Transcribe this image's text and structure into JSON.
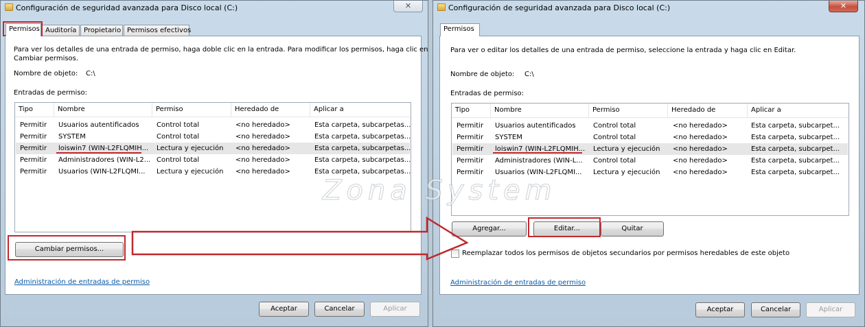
{
  "left_window": {
    "title": "Configuración de seguridad avanzada para Disco local (C:)",
    "bg_title": "Disco local (C:)",
    "close_label": "✕",
    "tabs": [
      "Permisos",
      "Auditoría",
      "Propietario",
      "Permisos efectivos"
    ],
    "description": "Para ver los detalles de una entrada de permiso, haga doble clic en la entrada. Para modificar los permisos, haga clic en",
    "description_2": "Cambiar permisos.",
    "object_name_label": "Nombre de objeto:",
    "object_name_value": "C:\\",
    "entries_label": "Entradas de permiso:",
    "columns": [
      "Tipo",
      "Nombre",
      "Permiso",
      "Heredado de",
      "Aplicar a"
    ],
    "rows": [
      {
        "tipo": "Permitir",
        "nombre": "Usuarios autentificados",
        "permiso": "Control total",
        "heredado": "<no heredado>",
        "aplicar": "Esta carpeta, subcarpetas..."
      },
      {
        "tipo": "Permitir",
        "nombre": "SYSTEM",
        "permiso": "Control total",
        "heredado": "<no heredado>",
        "aplicar": "Esta carpeta, subcarpetas..."
      },
      {
        "tipo": "Permitir",
        "nombre": "loiswin7 (WIN-L2FLQMIH...",
        "permiso": "Lectura y ejecución",
        "heredado": "<no heredado>",
        "aplicar": "Esta carpeta, subcarpetas..."
      },
      {
        "tipo": "Permitir",
        "nombre": "Administradores (WIN-L2...",
        "permiso": "Control total",
        "heredado": "<no heredado>",
        "aplicar": "Esta carpeta, subcarpetas..."
      },
      {
        "tipo": "Permitir",
        "nombre": "Usuarios (WIN-L2FLQMI...",
        "permiso": "Lectura y ejecución",
        "heredado": "<no heredado>",
        "aplicar": "Esta carpeta, subcarpetas..."
      }
    ],
    "selected_row": 2,
    "change_button": "Cambiar permisos...",
    "admin_link": "Administración de entradas de permiso",
    "ok_button": "Aceptar",
    "cancel_button": "Cancelar",
    "apply_button": "Aplicar"
  },
  "right_window": {
    "title": "Configuración de seguridad avanzada para Disco local (C:)",
    "close_label": "✕",
    "tab": "Permisos",
    "description": "Para ver o editar los detalles de una entrada de permiso, seleccione la entrada y haga clic en Editar.",
    "object_name_label": "Nombre de objeto:",
    "object_name_value": "C:\\",
    "entries_label": "Entradas de permiso:",
    "columns": [
      "Tipo",
      "Nombre",
      "Permiso",
      "Heredado de",
      "Aplicar a"
    ],
    "rows": [
      {
        "tipo": "Permitir",
        "nombre": "Usuarios autentificados",
        "permiso": "Control total",
        "heredado": "<no heredado>",
        "aplicar": "Esta carpeta, subcarpet..."
      },
      {
        "tipo": "Permitir",
        "nombre": "SYSTEM",
        "permiso": "Control total",
        "heredado": "<no heredado>",
        "aplicar": "Esta carpeta, subcarpet..."
      },
      {
        "tipo": "Permitir",
        "nombre": "loiswin7 (WIN-L2FLQMIH...",
        "permiso": "Lectura y ejecución",
        "heredado": "<no heredado>",
        "aplicar": "Esta carpeta, subcarpet..."
      },
      {
        "tipo": "Permitir",
        "nombre": "Administradores (WIN-L...",
        "permiso": "Control total",
        "heredado": "<no heredado>",
        "aplicar": "Esta carpeta, subcarpet..."
      },
      {
        "tipo": "Permitir",
        "nombre": "Usuarios (WIN-L2FLQMI...",
        "permiso": "Lectura y ejecución",
        "heredado": "<no heredado>",
        "aplicar": "Esta carpeta, subcarpet..."
      }
    ],
    "selected_row": 2,
    "add_button": "Agregar...",
    "edit_button": "Editar...",
    "remove_button": "Quitar",
    "replace_checkbox_label": "Reemplazar todos los permisos de objetos secundarios por permisos heredables de este objeto",
    "replace_checked": false,
    "admin_link": "Administración de entradas de permiso",
    "ok_button": "Aceptar",
    "cancel_button": "Cancelar",
    "apply_button": "Aplicar"
  },
  "watermark": "Zona System",
  "colors": {
    "highlight": "#c0282d",
    "link": "#0a5aa6",
    "selected_row": "#e6e6e6"
  }
}
